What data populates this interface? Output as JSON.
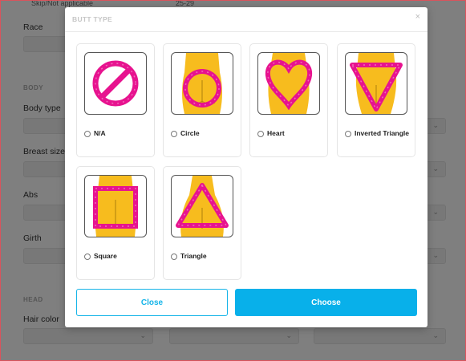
{
  "background": {
    "top_left_value": "Skip/Not applicable",
    "top_mid_value": "25-29",
    "race_label": "Race",
    "body_section": "BODY",
    "body_type_label": "Body type",
    "breast_size_label": "Breast size",
    "abs_label": "Abs",
    "girth_label": "Girth",
    "head_section": "HEAD",
    "hair_color_label": "Hair color"
  },
  "modal": {
    "title": "BUTT TYPE",
    "close_glyph": "×",
    "options": [
      {
        "label": "N/A",
        "shape": "na"
      },
      {
        "label": "Circle",
        "shape": "circle"
      },
      {
        "label": "Heart",
        "shape": "heart"
      },
      {
        "label": "Inverted Triangle",
        "shape": "inverted-triangle"
      },
      {
        "label": "Square",
        "shape": "square"
      },
      {
        "label": "Triangle",
        "shape": "triangle"
      }
    ],
    "close_button": "Close",
    "choose_button": "Choose"
  },
  "colors": {
    "accent": "#08b0ea",
    "shape_stroke": "#e7138f",
    "skin": "#f7bc1e",
    "overlay": "rgba(0,0,0,0.5)"
  }
}
